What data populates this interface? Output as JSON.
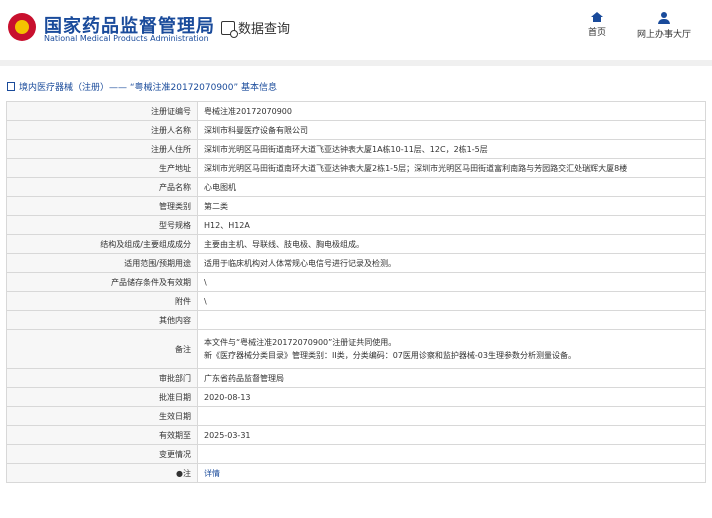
{
  "header": {
    "org_cn": "国家药品监督管理局",
    "org_en": "National Medical Products Administration",
    "query_label": "数据查询",
    "nav": [
      {
        "label": "首页",
        "icon": "home-icon"
      },
      {
        "label": "网上办事大厅",
        "icon": "user-icon"
      }
    ]
  },
  "breadcrumb": {
    "text": "境内医疗器械（注册）—— “粤械注准20172070900” 基本信息"
  },
  "rows": [
    {
      "label": "注册证编号",
      "value": "粤械注准20172070900"
    },
    {
      "label": "注册人名称",
      "value": "深圳市科曼医疗设备有限公司"
    },
    {
      "label": "注册人住所",
      "value": "深圳市光明区马田街道南环大道飞亚达钟表大厦1A栋10-11层、12C，2栋1-5层"
    },
    {
      "label": "生产地址",
      "value": "深圳市光明区马田街道南环大道飞亚达钟表大厦2栋1-5层；深圳市光明区马田街道富利南路与芳园路交汇处瑞辉大厦8楼"
    },
    {
      "label": "产品名称",
      "value": "心电图机"
    },
    {
      "label": "管理类别",
      "value": "第二类"
    },
    {
      "label": "型号规格",
      "value": "H12、H12A"
    },
    {
      "label": "结构及组成/主要组成成分",
      "value": "主要由主机、导联线、肢电极、胸电极组成。"
    },
    {
      "label": "适用范围/预期用途",
      "value": "适用于临床机构对人体常规心电信号进行记录及检测。"
    },
    {
      "label": "产品储存条件及有效期",
      "value": "\\"
    },
    {
      "label": "附件",
      "value": "\\"
    },
    {
      "label": "其他内容",
      "value": ""
    },
    {
      "label": "备注",
      "value": "",
      "lines": [
        "本文件与“粤械注准20172070900”注册证共同使用。",
        "新《医疗器械分类目录》管理类别：II类，分类编码：07医用诊察和监护器械-03生理参数分析测量设备。"
      ]
    },
    {
      "label": "审批部门",
      "value": "广东省药品监督管理局"
    },
    {
      "label": "批准日期",
      "value": "2020-08-13"
    },
    {
      "label": "生效日期",
      "value": ""
    },
    {
      "label": "有效期至",
      "value": "2025-03-31"
    },
    {
      "label": "变更情况",
      "value": ""
    },
    {
      "label": "●注",
      "value": "详情",
      "link": true
    }
  ]
}
